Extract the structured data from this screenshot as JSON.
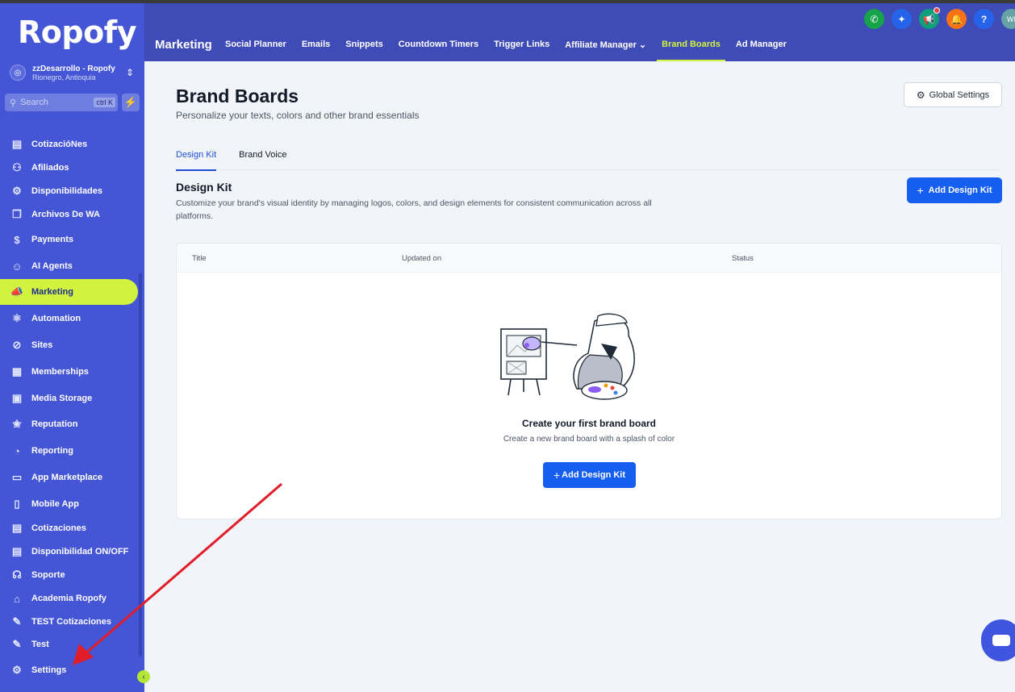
{
  "brand": {
    "logo_text": "Ropofy"
  },
  "account": {
    "name": "zzDesarrollo - Ropofy",
    "location": "Rionegro, Antioquia"
  },
  "search": {
    "placeholder": "Search",
    "shortcut": "ctrl K"
  },
  "sidebar": {
    "items": [
      {
        "label": "CotizacióNes",
        "icon": "file-icon"
      },
      {
        "label": "Afiliados",
        "icon": "users-icon"
      },
      {
        "label": "Disponibilidades",
        "icon": "cog-group-icon"
      },
      {
        "label": "Archivos De WA",
        "icon": "files-icon"
      },
      {
        "label": "Payments",
        "icon": "dollar-icon"
      },
      {
        "label": "AI Agents",
        "icon": "robot-icon"
      },
      {
        "label": "Marketing",
        "icon": "megaphone-icon",
        "active": true
      },
      {
        "label": "Automation",
        "icon": "automation-icon"
      },
      {
        "label": "Sites",
        "icon": "compass-icon"
      },
      {
        "label": "Memberships",
        "icon": "membership-icon"
      },
      {
        "label": "Media Storage",
        "icon": "image-icon"
      },
      {
        "label": "Reputation",
        "icon": "star-icon"
      },
      {
        "label": "Reporting",
        "icon": "chart-icon"
      },
      {
        "label": "App Marketplace",
        "icon": "store-icon"
      },
      {
        "label": "Mobile App",
        "icon": "phone-icon"
      },
      {
        "label": "Cotizaciones",
        "icon": "file-icon"
      },
      {
        "label": "Disponibilidad ON/OFF",
        "icon": "file-icon"
      },
      {
        "label": "Soporte",
        "icon": "headset-icon"
      },
      {
        "label": "Academia Ropofy",
        "icon": "graduation-icon"
      },
      {
        "label": "TEST Cotizaciones",
        "icon": "pencil-icon"
      },
      {
        "label": "Test",
        "icon": "pencil-icon"
      },
      {
        "label": "Settings",
        "icon": "gear-icon"
      }
    ]
  },
  "topnav": {
    "section": "Marketing",
    "tabs": [
      {
        "label": "Social Planner"
      },
      {
        "label": "Emails"
      },
      {
        "label": "Snippets"
      },
      {
        "label": "Countdown Timers"
      },
      {
        "label": "Trigger Links"
      },
      {
        "label": "Affiliate Manager ⌄"
      },
      {
        "label": "Brand Boards",
        "active": true
      },
      {
        "label": "Ad Manager"
      }
    ],
    "avatar_initials": "WI"
  },
  "page": {
    "title": "Brand Boards",
    "subtitle": "Personalize your texts, colors and other brand essentials",
    "global_settings": "Global Settings",
    "subtabs": [
      "Design Kit",
      "Brand Voice"
    ],
    "section_title": "Design Kit",
    "section_desc": "Customize your brand's visual identity by managing logos, colors, and design elements for consistent communication across all platforms.",
    "add_button": "Add Design Kit",
    "table_headers": [
      "Title",
      "Updated on",
      "Status"
    ],
    "empty_title": "Create your first brand board",
    "empty_sub": "Create a new brand board with a splash of color",
    "empty_button": "Add Design Kit"
  },
  "colors": {
    "sidebar_bg": "#4456d6",
    "topnav_bg": "#3f4cb8",
    "accent": "#d2f33e",
    "primary_button": "#155eef"
  }
}
